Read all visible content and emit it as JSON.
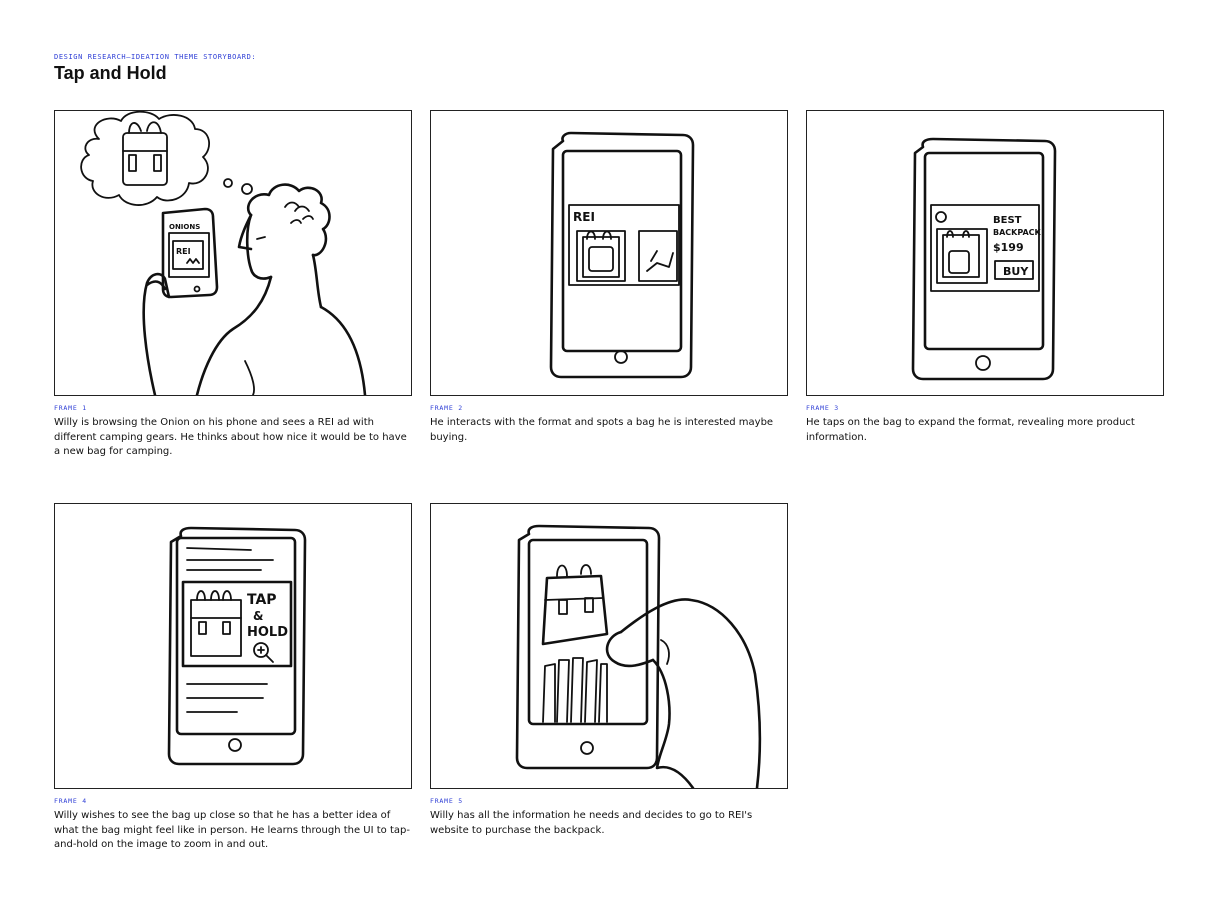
{
  "header": {
    "eyebrow": "DESIGN RESEARCH—IDEATION THEME STORYBOARD:",
    "title": "Tap and Hold"
  },
  "frames": [
    {
      "label": "FRAME 1",
      "caption": "Willy is browsing the Onion on his phone and sees a REI ad with different camping gears. He thinks about how nice it would be to have a new bag for camping.",
      "sketch_text": {
        "site": "ONIONS",
        "brand": "REI"
      }
    },
    {
      "label": "FRAME 2",
      "caption": "He interacts with the format and spots a bag he is interested maybe buying.",
      "sketch_text": {
        "brand": "REI"
      }
    },
    {
      "label": "FRAME 3",
      "caption": "He taps on the bag to expand the format, revealing more product information.",
      "sketch_text": {
        "line1": "BEST",
        "line2": "BACKPACK",
        "price": "$199",
        "buy": "BUY"
      }
    },
    {
      "label": "FRAME 4",
      "caption": "Willy wishes to see the bag up close so that he has a better idea of what the bag might feel like in person. He learns through the UI to tap-and-hold on the image to zoom in and out.",
      "sketch_text": {
        "line1": "TAP",
        "line2": "&",
        "line3": "HOLD"
      }
    },
    {
      "label": "FRAME 5",
      "caption": "Willy has all the information he needs and decides to go to REI's website to purchase the backpack.",
      "sketch_text": {}
    }
  ]
}
